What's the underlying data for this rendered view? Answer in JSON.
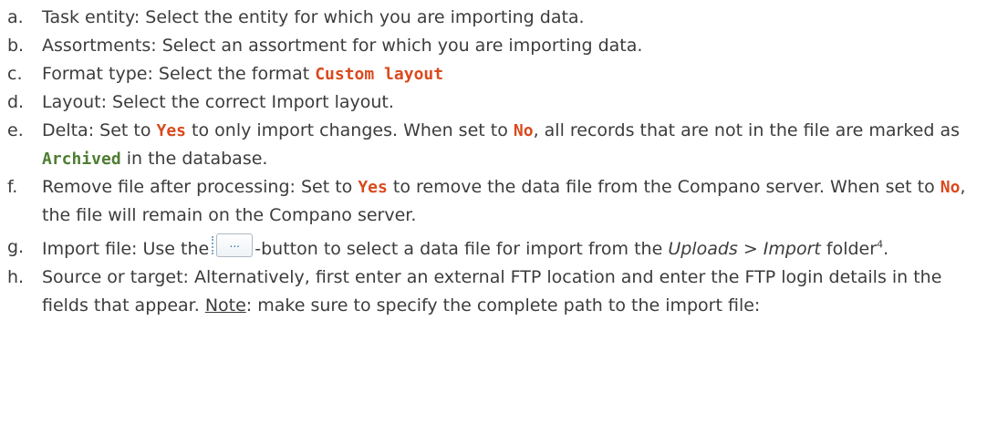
{
  "items": [
    {
      "letter": "a.",
      "label": "Task entity",
      "text": ": Select the entity for which you are importing data."
    },
    {
      "letter": "b.",
      "label": "Assortments",
      "text": ": Select an assortment for which you are importing data."
    },
    {
      "letter": "c.",
      "label": "Format type",
      "text": ": Select the format ",
      "code": "Custom layout"
    },
    {
      "letter": "d.",
      "label": "Layout",
      "text": ": Select the correct Import layout."
    },
    {
      "letter": "e.",
      "label": "Delta",
      "text1": ": Set to ",
      "code1": "Yes",
      "text2": " to only import changes. When set to ",
      "code2": "No",
      "text3": ", all records that are not in the file are marked as ",
      "code3": "Archived",
      "text4": " in the database."
    },
    {
      "letter": "f.",
      "label": "Remove file after processing",
      "text1": ": Set to ",
      "code1": "Yes",
      "text2": " to remove the data file from the Compano server. When set to ",
      "code2": "No",
      "text3": ", the file will remain on the Compano server."
    },
    {
      "letter": "g.",
      "label": "Import file",
      "text1": ": Use the ",
      "button_label": "...",
      "text2": "-button to select a data file for import from the ",
      "em1": "Uploads > Import",
      "text3": " folder",
      "footnote": "4",
      "text4": "."
    },
    {
      "letter": "h.",
      "label": "Source or target",
      "text1": ": Alternatively, first enter an external FTP location and enter the FTP login details in the fields that appear. ",
      "note": "Note",
      "text2": ": make sure to specify the complete path to the import file:"
    }
  ],
  "colors": {
    "text": "#3c3c3c",
    "code_red": "#d94a1e",
    "code_green": "#4e7d33"
  }
}
